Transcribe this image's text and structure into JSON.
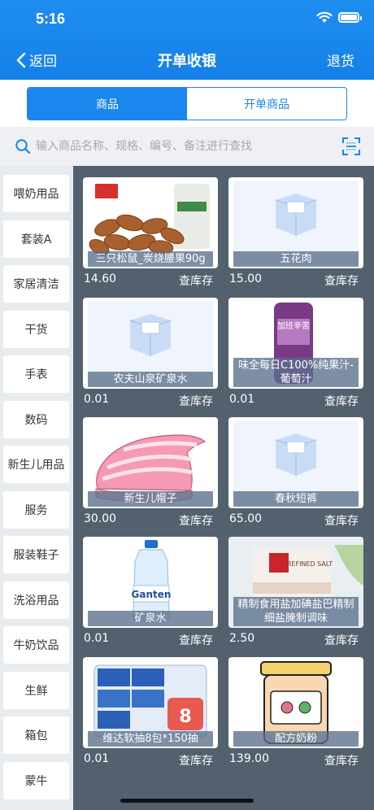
{
  "status_bar": {
    "time": "5:16"
  },
  "nav": {
    "back_label": "返回",
    "title": "开单收银",
    "right_label": "退货"
  },
  "tabs": [
    {
      "label": "商品",
      "active": true
    },
    {
      "label": "开单商品",
      "active": false
    }
  ],
  "search": {
    "placeholder": "输入商品名称、规格、编号、备注进行查找"
  },
  "categories": [
    "喂奶用品",
    "套装A",
    "家居清洁",
    "干货",
    "手表",
    "数码",
    "新生儿用品",
    "服务",
    "服装鞋子",
    "洗浴用品",
    "牛奶饮品",
    "生鲜",
    "箱包",
    "蒙牛"
  ],
  "products": [
    {
      "name": "三只松鼠_炭烧腰果90g",
      "price": "14.60",
      "stock_label": "查库存",
      "image": "nuts"
    },
    {
      "name": "五花肉",
      "price": "15.00",
      "stock_label": "查库存",
      "image": "placeholder-box"
    },
    {
      "name": "农夫山泉矿泉水",
      "price": "0.01",
      "stock_label": "查库存",
      "image": "placeholder-box"
    },
    {
      "name": "味全每日C100%纯果汁-葡萄汁",
      "price": "0.01",
      "stock_label": "查库存",
      "image": "juice",
      "image_text": "加班辛苦"
    },
    {
      "name": "新生儿帽子",
      "price": "30.00",
      "stock_label": "查库存",
      "image": "baby-hat"
    },
    {
      "name": "春秋短裤",
      "price": "65.00",
      "stock_label": "查库存",
      "image": "placeholder-box"
    },
    {
      "name": "矿泉水",
      "price": "0.01",
      "stock_label": "查库存",
      "image": "water-bottle",
      "image_text": "Ganten"
    },
    {
      "name": "精制食用盐加碘盐巴精制细盐腌制调味",
      "price": "2.50",
      "stock_label": "查库存",
      "image": "salt-bag",
      "image_text": "REFINED SALT"
    },
    {
      "name": "维达软抽8包*150抽",
      "price": "0.01",
      "stock_label": "查库存",
      "image": "tissue-pack",
      "image_text": "8"
    },
    {
      "name": "配方奶粉",
      "price": "139.00",
      "stock_label": "查库存",
      "image": "milk-powder"
    }
  ],
  "colors": {
    "primary": "#1a86ee",
    "content_bg": "#53606e",
    "label_bg": "#5a708c"
  }
}
